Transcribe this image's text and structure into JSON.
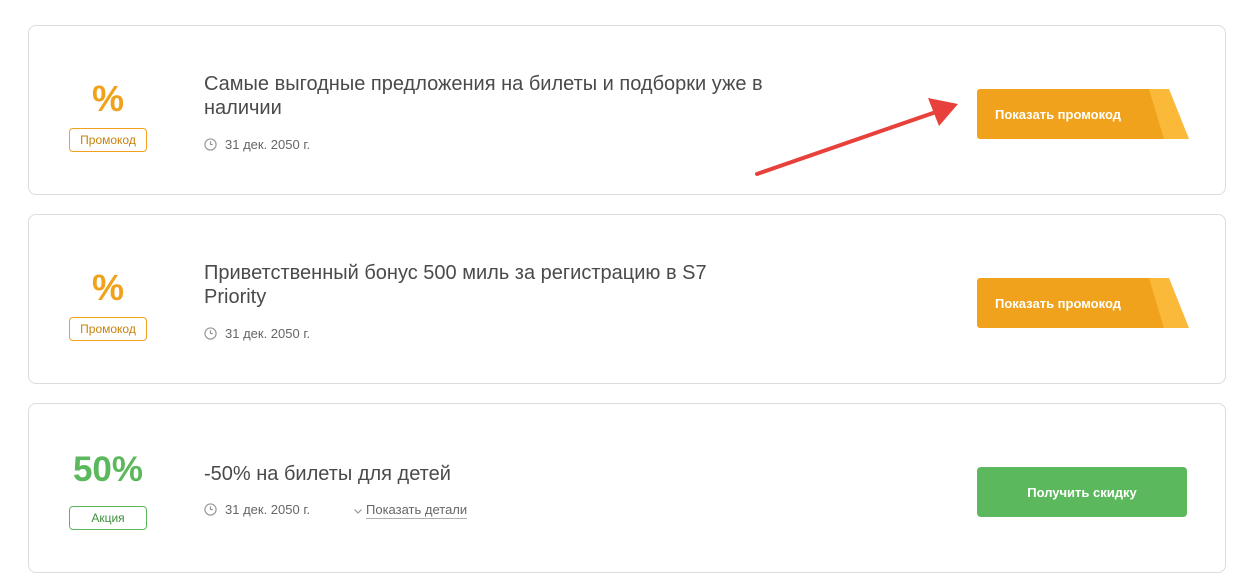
{
  "offers": [
    {
      "value": "%",
      "badge": "Промокод",
      "title": "Самые выгодные предложения на билеты и подборки уже в наличии",
      "date": "31 дек. 2050 г.",
      "button": "Показать промокод"
    },
    {
      "value": "%",
      "badge": "Промокод",
      "title": "Приветственный бонус 500 миль за регистрацию в S7 Priority",
      "date": "31 дек. 2050 г.",
      "button": "Показать промокод"
    },
    {
      "value": "50%",
      "badge": "Акция",
      "title": "-50% на билеты для детей",
      "date": "31 дек. 2050 г.",
      "details": "Показать детали",
      "button": "Получить скидку"
    }
  ],
  "colors": {
    "promo_accent": "#f0a21c",
    "sale_accent": "#5cb85c",
    "annotation_arrow": "#e8403a"
  },
  "icons": {
    "date": "clock-icon",
    "details": "chevron-down-icon",
    "annotation": "red-arrow-annotation"
  }
}
